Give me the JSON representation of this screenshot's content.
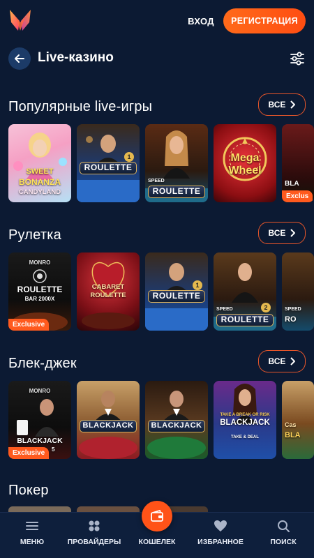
{
  "header": {
    "login_label": "ВХОД",
    "register_label": "РЕГИСТРАЦИЯ",
    "logo_icon": "brand-logo-icon"
  },
  "title_bar": {
    "title": "Live-казино",
    "back_icon": "arrow-left-icon",
    "filter_icon": "sliders-icon"
  },
  "sections": [
    {
      "title": "Популярные live-игры",
      "all_label": "ВСЕ",
      "games": [
        {
          "label_line1": "SWEET",
          "label_line2": "BONANZA",
          "label_line3": "CANDYLAND"
        },
        {
          "label": "ROULETTE",
          "badge": "1"
        },
        {
          "label": "ROULETTE",
          "prefix": "SPEED"
        },
        {
          "label_line1": "Mega",
          "label_line2": "Wheel"
        },
        {
          "label": "BLA",
          "exclusive": "Exclus"
        }
      ]
    },
    {
      "title": "Рулетка",
      "all_label": "ВСЕ",
      "games": [
        {
          "brand": "MONRO",
          "label": "ROULETTE",
          "sub": "BAR 2000X",
          "exclusive": "Exclusive"
        },
        {
          "label_line1": "CABARET",
          "label_line2": "ROULETTE"
        },
        {
          "label": "ROULETTE",
          "badge": "1"
        },
        {
          "label": "ROULETTE",
          "prefix": "SPEED",
          "badge": "2"
        },
        {
          "label": "RO",
          "prefix": "SPEED"
        }
      ]
    },
    {
      "title": "Блек-джек",
      "all_label": "ВСЕ",
      "games": [
        {
          "brand": "MONRO",
          "label": "BLACKJACK",
          "sub": "5",
          "exclusive": "Exclusive"
        },
        {
          "label": "BLACKJACK"
        },
        {
          "label": "BLACKJACK"
        },
        {
          "label": "BLACKJACK",
          "prefix": "TAKE A BREAK OR RISK",
          "sub": "TAKE & DEAL"
        },
        {
          "label": "BLA",
          "prefix": "Cas"
        }
      ]
    },
    {
      "title": "Покер"
    }
  ],
  "bottom_nav": {
    "items": [
      {
        "label": "МЕНЮ",
        "icon": "menu-icon"
      },
      {
        "label": "ПРОВАЙДЕРЫ",
        "icon": "grid-icon"
      },
      {
        "label": "КОШЕЛЕК",
        "icon": "wallet-icon"
      },
      {
        "label": "ИЗБРАННОЕ",
        "icon": "heart-icon"
      },
      {
        "label": "ПОИСК",
        "icon": "search-icon"
      }
    ]
  },
  "colors": {
    "background": "#0c1a33",
    "accent": "#ff5a1e",
    "nav_background": "#0e1f3c"
  }
}
